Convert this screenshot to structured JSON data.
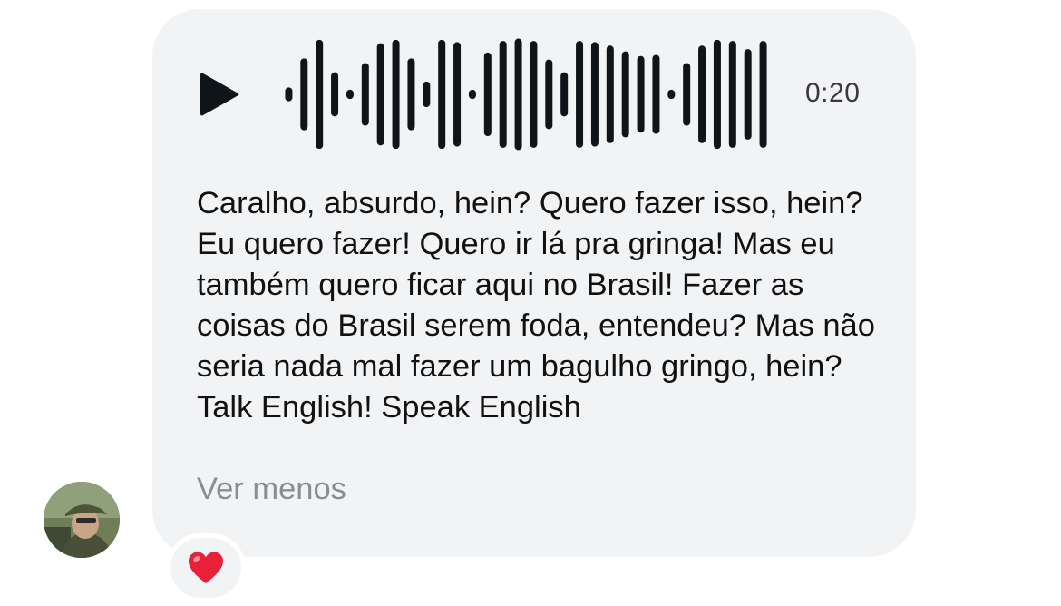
{
  "voice_message": {
    "duration": "0:20",
    "waveform_levels": [
      0.12,
      0.62,
      0.94,
      0.38,
      0.08,
      0.54,
      0.88,
      0.94,
      0.62,
      0.22,
      0.94,
      0.9,
      0.08,
      0.72,
      0.92,
      0.96,
      0.92,
      0.6,
      0.38,
      0.92,
      0.9,
      0.84,
      0.74,
      0.66,
      0.68,
      0.08,
      0.54,
      0.84,
      0.94,
      0.92,
      0.78,
      0.92
    ]
  },
  "transcript": {
    "text": "Caralho, absurdo, hein? Quero fazer isso, hein? Eu quero fazer! Quero ir lá pra gringa! Mas eu também quero ficar aqui no Brasil! Fazer as coisas do Brasil serem foda, entendeu? Mas não seria nada mal fazer um bagulho gringo, hein? Talk English! Speak English",
    "toggle_label": "Ver menos"
  },
  "reaction": {
    "emoji": "❤️"
  },
  "colors": {
    "bubble_bg": "#f2f3f5",
    "wave_color": "#0f1419",
    "secondary_text": "#8a8d91",
    "heart": "#e8203a"
  }
}
